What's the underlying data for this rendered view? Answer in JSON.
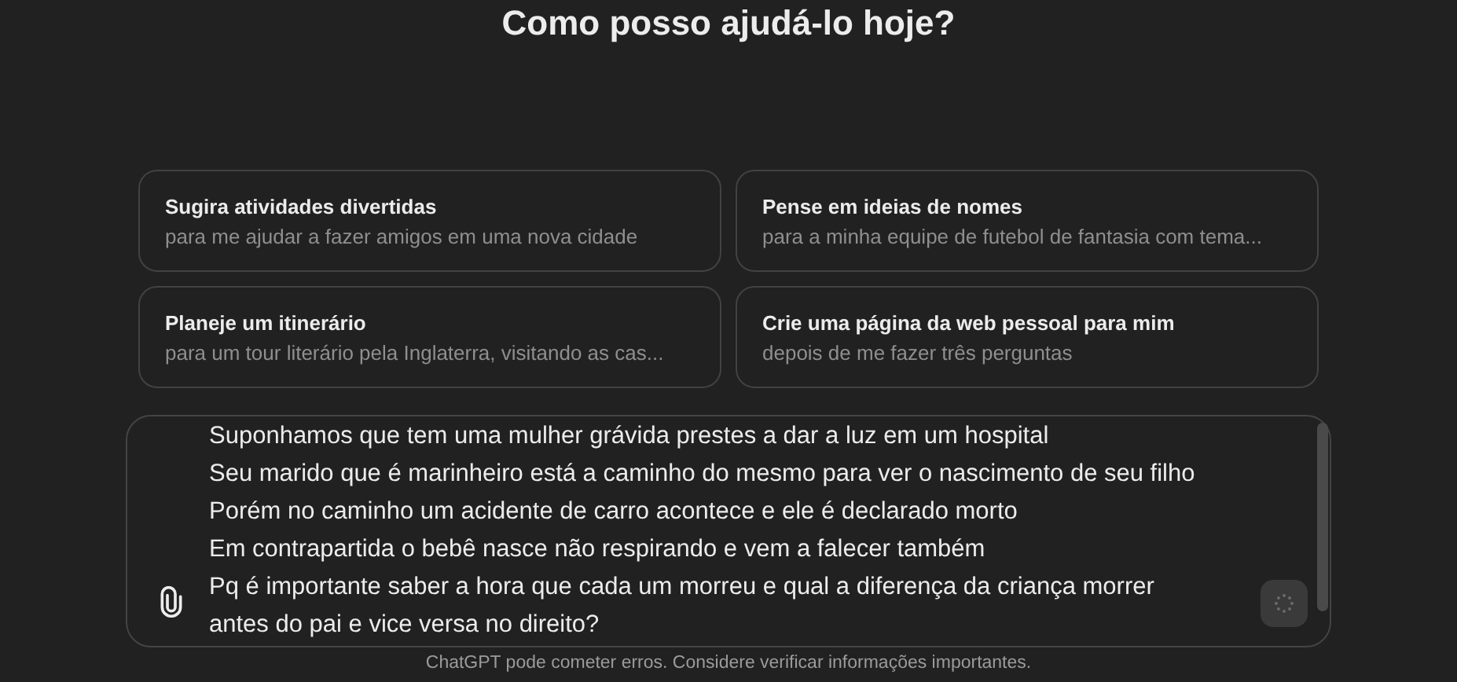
{
  "heading": "Como posso ajudá-lo hoje?",
  "suggestions": [
    {
      "title": "Sugira atividades divertidas",
      "subtitle": "para me ajudar a fazer amigos em uma nova cidade"
    },
    {
      "title": "Pense em ideias de nomes",
      "subtitle": "para a minha equipe de futebol de fantasia com tema..."
    },
    {
      "title": "Planeje um itinerário",
      "subtitle": "para um tour literário pela Inglaterra, visitando as cas..."
    },
    {
      "title": "Crie uma página da web pessoal para mim",
      "subtitle": "depois de me fazer três perguntas"
    }
  ],
  "composer": {
    "lines": [
      "Suponhamos que tem uma mulher grávida prestes a dar a luz em um hospital",
      "Seu marido que é marinheiro está a caminho do mesmo para ver o nascimento de seu filho",
      "Porém no caminho um acidente de carro acontece e ele é declarado morto",
      "Em contrapartida o bebê nasce não respirando e vem a falecer também",
      "Pq é importante saber a hora que cada um morreu e qual a diferença da criança morrer",
      "antes do pai e vice versa no direito?"
    ],
    "send_disabled": true
  },
  "footer": "ChatGPT pode cometer erros. Considere verificar informações importantes."
}
